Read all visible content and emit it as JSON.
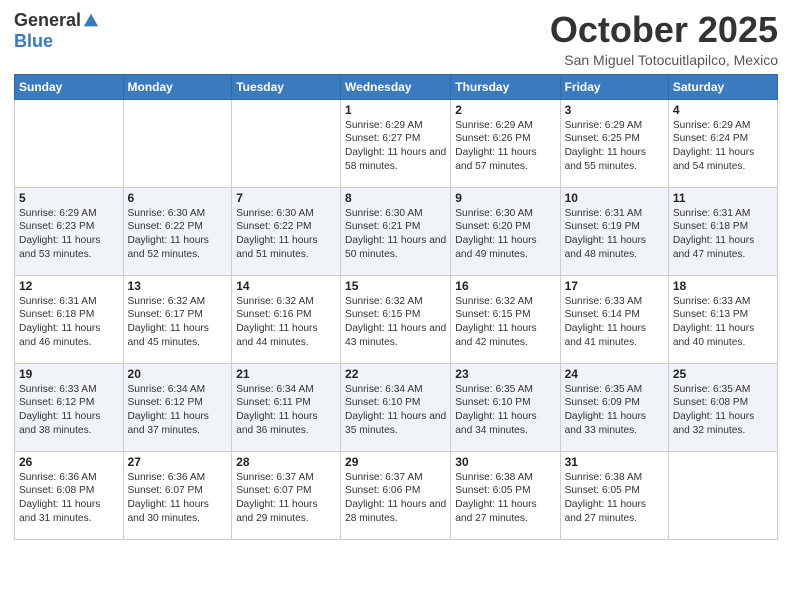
{
  "logo": {
    "general": "General",
    "blue": "Blue"
  },
  "title": {
    "month": "October 2025",
    "location": "San Miguel Totocuitlapilco, Mexico"
  },
  "days_of_week": [
    "Sunday",
    "Monday",
    "Tuesday",
    "Wednesday",
    "Thursday",
    "Friday",
    "Saturday"
  ],
  "weeks": [
    [
      {
        "day": "",
        "info": ""
      },
      {
        "day": "",
        "info": ""
      },
      {
        "day": "",
        "info": ""
      },
      {
        "day": "1",
        "info": "Sunrise: 6:29 AM\nSunset: 6:27 PM\nDaylight: 11 hours\nand 58 minutes."
      },
      {
        "day": "2",
        "info": "Sunrise: 6:29 AM\nSunset: 6:26 PM\nDaylight: 11 hours\nand 57 minutes."
      },
      {
        "day": "3",
        "info": "Sunrise: 6:29 AM\nSunset: 6:25 PM\nDaylight: 11 hours\nand 55 minutes."
      },
      {
        "day": "4",
        "info": "Sunrise: 6:29 AM\nSunset: 6:24 PM\nDaylight: 11 hours\nand 54 minutes."
      }
    ],
    [
      {
        "day": "5",
        "info": "Sunrise: 6:29 AM\nSunset: 6:23 PM\nDaylight: 11 hours\nand 53 minutes."
      },
      {
        "day": "6",
        "info": "Sunrise: 6:30 AM\nSunset: 6:22 PM\nDaylight: 11 hours\nand 52 minutes."
      },
      {
        "day": "7",
        "info": "Sunrise: 6:30 AM\nSunset: 6:22 PM\nDaylight: 11 hours\nand 51 minutes."
      },
      {
        "day": "8",
        "info": "Sunrise: 6:30 AM\nSunset: 6:21 PM\nDaylight: 11 hours\nand 50 minutes."
      },
      {
        "day": "9",
        "info": "Sunrise: 6:30 AM\nSunset: 6:20 PM\nDaylight: 11 hours\nand 49 minutes."
      },
      {
        "day": "10",
        "info": "Sunrise: 6:31 AM\nSunset: 6:19 PM\nDaylight: 11 hours\nand 48 minutes."
      },
      {
        "day": "11",
        "info": "Sunrise: 6:31 AM\nSunset: 6:18 PM\nDaylight: 11 hours\nand 47 minutes."
      }
    ],
    [
      {
        "day": "12",
        "info": "Sunrise: 6:31 AM\nSunset: 6:18 PM\nDaylight: 11 hours\nand 46 minutes."
      },
      {
        "day": "13",
        "info": "Sunrise: 6:32 AM\nSunset: 6:17 PM\nDaylight: 11 hours\nand 45 minutes."
      },
      {
        "day": "14",
        "info": "Sunrise: 6:32 AM\nSunset: 6:16 PM\nDaylight: 11 hours\nand 44 minutes."
      },
      {
        "day": "15",
        "info": "Sunrise: 6:32 AM\nSunset: 6:15 PM\nDaylight: 11 hours\nand 43 minutes."
      },
      {
        "day": "16",
        "info": "Sunrise: 6:32 AM\nSunset: 6:15 PM\nDaylight: 11 hours\nand 42 minutes."
      },
      {
        "day": "17",
        "info": "Sunrise: 6:33 AM\nSunset: 6:14 PM\nDaylight: 11 hours\nand 41 minutes."
      },
      {
        "day": "18",
        "info": "Sunrise: 6:33 AM\nSunset: 6:13 PM\nDaylight: 11 hours\nand 40 minutes."
      }
    ],
    [
      {
        "day": "19",
        "info": "Sunrise: 6:33 AM\nSunset: 6:12 PM\nDaylight: 11 hours\nand 38 minutes."
      },
      {
        "day": "20",
        "info": "Sunrise: 6:34 AM\nSunset: 6:12 PM\nDaylight: 11 hours\nand 37 minutes."
      },
      {
        "day": "21",
        "info": "Sunrise: 6:34 AM\nSunset: 6:11 PM\nDaylight: 11 hours\nand 36 minutes."
      },
      {
        "day": "22",
        "info": "Sunrise: 6:34 AM\nSunset: 6:10 PM\nDaylight: 11 hours\nand 35 minutes."
      },
      {
        "day": "23",
        "info": "Sunrise: 6:35 AM\nSunset: 6:10 PM\nDaylight: 11 hours\nand 34 minutes."
      },
      {
        "day": "24",
        "info": "Sunrise: 6:35 AM\nSunset: 6:09 PM\nDaylight: 11 hours\nand 33 minutes."
      },
      {
        "day": "25",
        "info": "Sunrise: 6:35 AM\nSunset: 6:08 PM\nDaylight: 11 hours\nand 32 minutes."
      }
    ],
    [
      {
        "day": "26",
        "info": "Sunrise: 6:36 AM\nSunset: 6:08 PM\nDaylight: 11 hours\nand 31 minutes."
      },
      {
        "day": "27",
        "info": "Sunrise: 6:36 AM\nSunset: 6:07 PM\nDaylight: 11 hours\nand 30 minutes."
      },
      {
        "day": "28",
        "info": "Sunrise: 6:37 AM\nSunset: 6:07 PM\nDaylight: 11 hours\nand 29 minutes."
      },
      {
        "day": "29",
        "info": "Sunrise: 6:37 AM\nSunset: 6:06 PM\nDaylight: 11 hours\nand 28 minutes."
      },
      {
        "day": "30",
        "info": "Sunrise: 6:38 AM\nSunset: 6:05 PM\nDaylight: 11 hours\nand 27 minutes."
      },
      {
        "day": "31",
        "info": "Sunrise: 6:38 AM\nSunset: 6:05 PM\nDaylight: 11 hours\nand 27 minutes."
      },
      {
        "day": "",
        "info": ""
      }
    ]
  ]
}
